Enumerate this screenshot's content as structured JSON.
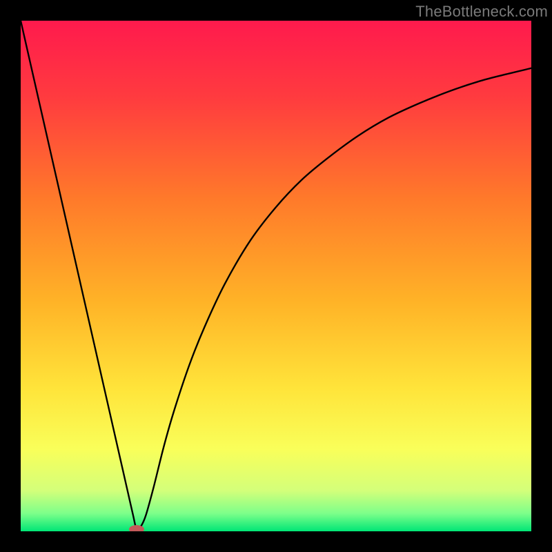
{
  "watermark": {
    "text": "TheBottleneck.com"
  },
  "chart_data": {
    "type": "line",
    "title": "",
    "xlabel": "",
    "ylabel": "",
    "xlim": [
      0,
      100
    ],
    "ylim": [
      0,
      100
    ],
    "gradient_stops": [
      {
        "offset": 0.0,
        "color": "#ff1a4d"
      },
      {
        "offset": 0.15,
        "color": "#ff3b3f"
      },
      {
        "offset": 0.35,
        "color": "#ff7a2a"
      },
      {
        "offset": 0.55,
        "color": "#ffb327"
      },
      {
        "offset": 0.72,
        "color": "#ffe43a"
      },
      {
        "offset": 0.84,
        "color": "#f9ff5a"
      },
      {
        "offset": 0.92,
        "color": "#d4ff7a"
      },
      {
        "offset": 0.965,
        "color": "#7dff8a"
      },
      {
        "offset": 1.0,
        "color": "#00e676"
      }
    ],
    "series": [
      {
        "name": "bottleneck-curve",
        "x": [
          0,
          2,
          4,
          6,
          8,
          10,
          12,
          14,
          16,
          18,
          20,
          21,
          22,
          22.7,
          23.5,
          24.5,
          26,
          28,
          30,
          33,
          36,
          40,
          45,
          50,
          55,
          60,
          66,
          72,
          78,
          84,
          90,
          95,
          100
        ],
        "y": [
          100,
          91.2,
          82.4,
          73.6,
          64.8,
          56,
          47.2,
          38.4,
          29.6,
          20.8,
          12,
          7.6,
          3.2,
          0.4,
          0.9,
          3.1,
          8.5,
          16.5,
          23.5,
          32.5,
          40.0,
          48.5,
          57.0,
          63.5,
          68.8,
          73.0,
          77.4,
          81.0,
          83.8,
          86.2,
          88.2,
          89.5,
          90.7
        ]
      }
    ],
    "marker": {
      "x": 22.7,
      "y": 0.4,
      "color": "#c45a5a",
      "rx": 11,
      "ry": 6
    }
  }
}
